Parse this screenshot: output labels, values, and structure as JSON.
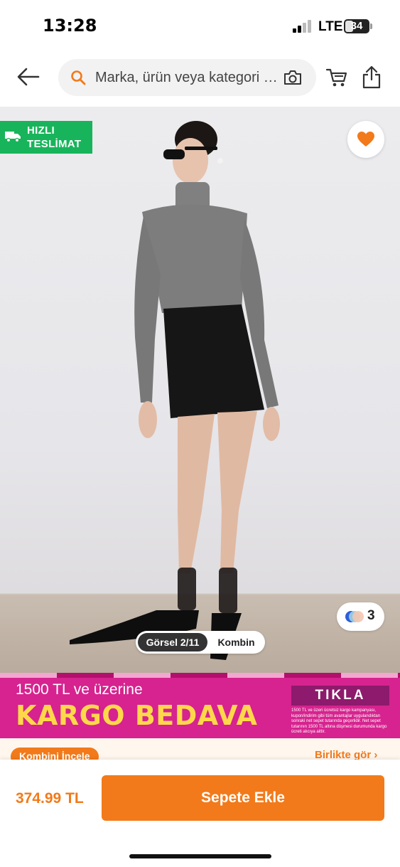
{
  "status_bar": {
    "time": "13:28",
    "network": "LTE",
    "battery": "34",
    "battery_level": 0.34
  },
  "nav": {
    "back_icon": "arrow-left-icon",
    "search_placeholder": "Marka, ürün veya kategori ara",
    "camera_icon": "camera-icon",
    "cart_icon": "cart-icon",
    "share_icon": "share-icon"
  },
  "gallery": {
    "fast_badge_line1": "HIZLI",
    "fast_badge_line2": "TESLİMAT",
    "favorite_icon": "heart-icon",
    "favorited": true,
    "color_count": "3",
    "tab_active": "Görsel 2/11",
    "tab_inactive": "Kombin"
  },
  "promo": {
    "line1": "1500 TL ve üzerine",
    "line2": "KARGO BEDAVA",
    "cta": "TIKLA",
    "fine_print": "1500 TL ve üzeri ücretsiz kargo kampanyası, kupon/indirim gibi tüm avantajlar uygulandıktan sonraki net sepet tutarında geçerlidir. Net sepet tutarının 1500 TL altına düşmesi durumunda kargo ücreti alıcıya aittir."
  },
  "strip": {
    "kombin_label": "Kombini İncele",
    "birlikte_label": "Birlikte gör ›"
  },
  "bottom": {
    "price": "374.99 TL",
    "add_to_cart": "Sepete Ekle"
  },
  "colors": {
    "brand": "#f27a1a",
    "fast_green": "#18b45b",
    "promo_pink": "#d6238f",
    "promo_yellow": "#ffd84a"
  }
}
